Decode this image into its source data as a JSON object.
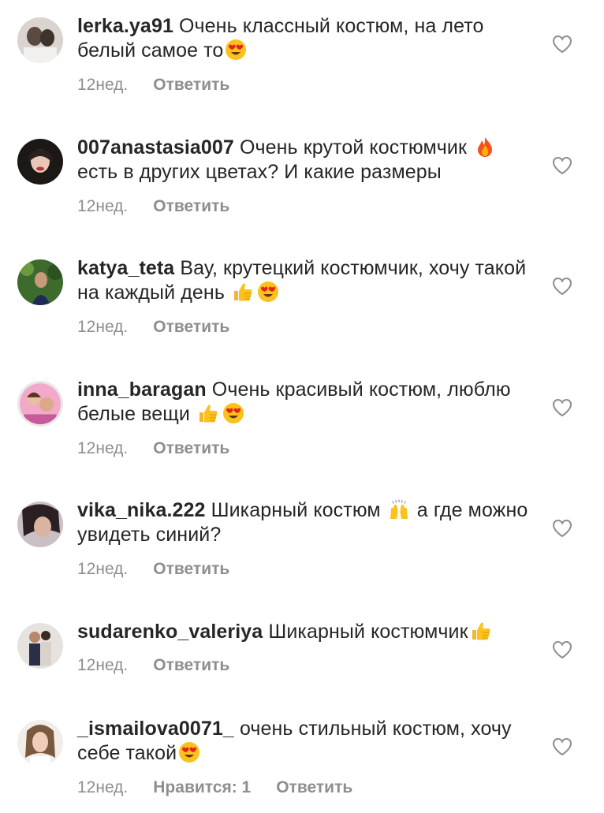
{
  "comments": [
    {
      "username": "lerka.ya91",
      "text_parts": [
        "Очень классный костюм, на лето белый самое то"
      ],
      "emojis": [
        "heart-eyes-emoji"
      ],
      "age": "12нед.",
      "reply_label": "Ответить",
      "likes_label": ""
    },
    {
      "username": "007anastasia007",
      "text_parts": [
        "Очень крутой костюмчик",
        "есть в других цветах? И какие размеры"
      ],
      "emojis": [
        "fire-emoji"
      ],
      "age": "12нед.",
      "reply_label": "Ответить",
      "likes_label": ""
    },
    {
      "username": "katya_teta",
      "text_parts": [
        "Вау, крутецкий костюмчик, хочу такой на каждый день"
      ],
      "emojis": [
        "thumbs-up-emoji",
        "heart-eyes-emoji"
      ],
      "age": "12нед.",
      "reply_label": "Ответить",
      "likes_label": ""
    },
    {
      "username": "inna_baragan",
      "text_parts": [
        "Очень красивый костюм, люблю белые вещи"
      ],
      "emojis": [
        "thumbs-up-emoji",
        "heart-eyes-emoji"
      ],
      "age": "12нед.",
      "reply_label": "Ответить",
      "likes_label": ""
    },
    {
      "username": "vika_nika.222",
      "text_parts": [
        "Шикарный костюм",
        "а где можно увидеть синий?"
      ],
      "emojis": [
        "raising-hands-emoji"
      ],
      "age": "12нед.",
      "reply_label": "Ответить",
      "likes_label": ""
    },
    {
      "username": "sudarenko_valeriya",
      "text_parts": [
        "Шикарный костюмчик"
      ],
      "emojis": [
        "thumbs-up-emoji"
      ],
      "age": "12нед.",
      "reply_label": "Ответить",
      "likes_label": ""
    },
    {
      "username": "_ismailova0071_",
      "text_parts": [
        "очень стильный костюм, хочу себе такой"
      ],
      "emojis": [
        "heart-eyes-emoji"
      ],
      "age": "12нед.",
      "reply_label": "Ответить",
      "likes_label": "Нравится: 1"
    }
  ],
  "icons": {
    "like": "heart-outline-icon"
  },
  "colors": {
    "text": "#262626",
    "secondary": "#8e8e8e",
    "background": "#ffffff"
  }
}
